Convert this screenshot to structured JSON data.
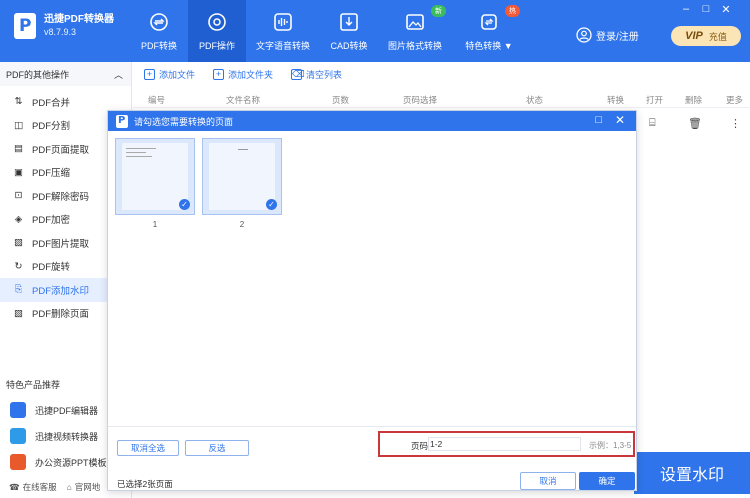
{
  "app": {
    "name": "迅捷PDF转换器",
    "version": "v8.7.9.3"
  },
  "nav": [
    {
      "label": "PDF转换",
      "icon": "convert-icon",
      "active": false
    },
    {
      "label": "PDF操作",
      "icon": "gear-icon",
      "active": true
    },
    {
      "label": "文字语音转换",
      "icon": "audio-icon",
      "active": false
    },
    {
      "label": "CAD转换",
      "icon": "cad-icon",
      "active": false
    },
    {
      "label": "图片格式转换",
      "icon": "image-icon",
      "active": false,
      "badge": "新"
    },
    {
      "label": "特色转换 ▼",
      "icon": "special-convert-icon",
      "active": false,
      "badge": "热"
    }
  ],
  "header": {
    "login_label": "登录/注册",
    "vip_mark": "VIP",
    "vip_label": "充值"
  },
  "window_controls": {
    "minimize": "–",
    "maximize": "□",
    "close": "✕"
  },
  "sidebar": {
    "title": "PDF的其他操作",
    "items": [
      {
        "label": "PDF合并",
        "active": false
      },
      {
        "label": "PDF分割",
        "active": false
      },
      {
        "label": "PDF页面提取",
        "active": false
      },
      {
        "label": "PDF压缩",
        "active": false
      },
      {
        "label": "PDF解除密码",
        "active": false
      },
      {
        "label": "PDF加密",
        "active": false
      },
      {
        "label": "PDF图片提取",
        "active": false
      },
      {
        "label": "PDF旋转",
        "active": false
      },
      {
        "label": "PDF添加水印",
        "active": true
      },
      {
        "label": "PDF删除页面",
        "active": false
      }
    ],
    "recommend_title": "特色产品推荐",
    "recommend": [
      {
        "label": "迅捷PDF编辑器",
        "color": "#2f74ea"
      },
      {
        "label": "迅捷视频转换器",
        "color": "#2f9be8"
      },
      {
        "label": "办公资源PPT模板",
        "color": "#e85a2b"
      }
    ],
    "footer": {
      "service": "在线客服",
      "website": "官网地"
    }
  },
  "toolbar": {
    "add_file": "添加文件",
    "add_folder": "添加文件夹",
    "clear_list": "清空列表"
  },
  "table": {
    "columns": [
      "编号",
      "文件名称",
      "页数",
      "页码选择",
      "状态",
      "转换",
      "打开",
      "删除",
      "更多"
    ]
  },
  "set_watermark_button": "设置水印",
  "dialog": {
    "title": "请勾选您需要转换的页面",
    "pages": [
      {
        "number": "1",
        "checked": true
      },
      {
        "number": "2",
        "checked": true
      }
    ],
    "deselect_all": "取消全选",
    "invert": "反选",
    "page_label": "页码",
    "page_value": "1-2",
    "page_hint": "示例：1,3-5",
    "selected_count": "已选择2张页面",
    "cancel": "取消",
    "confirm": "确定"
  }
}
